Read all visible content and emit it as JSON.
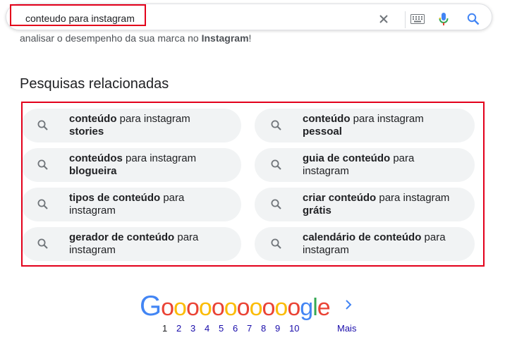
{
  "search": {
    "query": "conteudo para instagram",
    "icons": [
      "close-icon",
      "keyboard-icon",
      "microphone-icon",
      "search-icon"
    ]
  },
  "snippet": {
    "prefix": "analisar o desempenho da sua marca no ",
    "bold": "Instagram",
    "suffix": "!"
  },
  "related": {
    "title": "Pesquisas relacionadas",
    "items": [
      {
        "bold1": "conteúdo",
        "normal": " para instagram",
        "bold2": "stories",
        "normal2": ""
      },
      {
        "bold1": "conteúdo",
        "normal": " para instagram",
        "bold2": "pessoal",
        "normal2": ""
      },
      {
        "bold1": "conteúdos",
        "normal": " para instagram",
        "bold2": "blogueira",
        "normal2": ""
      },
      {
        "bold1": "guia de conteúdo",
        "normal": " para",
        "bold2": "",
        "normal2": "instagram"
      },
      {
        "bold1": "tipos de conteúdo",
        "normal": " para",
        "bold2": "",
        "normal2": "instagram"
      },
      {
        "bold1": "criar conteúdo",
        "normal": " para instagram",
        "bold2": "grátis",
        "normal2": ""
      },
      {
        "bold1": "gerador de conteúdo",
        "normal": " para",
        "bold2": "",
        "normal2": "instagram"
      },
      {
        "bold1": "calendário de conteúdo",
        "normal": " para",
        "bold2": "",
        "normal2": "instagram"
      }
    ]
  },
  "pagination": {
    "logo_letters": [
      "G",
      "o",
      "o",
      "o",
      "o",
      "o",
      "o",
      "o",
      "o",
      "o",
      "o",
      "o",
      "g",
      "l",
      "e"
    ],
    "logo_colors": {
      "blue": "#4285f4",
      "red": "#ea4335",
      "yellow": "#fbbc05",
      "green": "#34a853"
    },
    "pages": [
      "1",
      "2",
      "3",
      "4",
      "5",
      "6",
      "7",
      "8",
      "9",
      "10"
    ],
    "current_page": "1",
    "more_label": "Mais"
  },
  "colors": {
    "highlight": "#e3001b",
    "link": "#1a0dab",
    "chip_bg": "#f1f3f4"
  }
}
